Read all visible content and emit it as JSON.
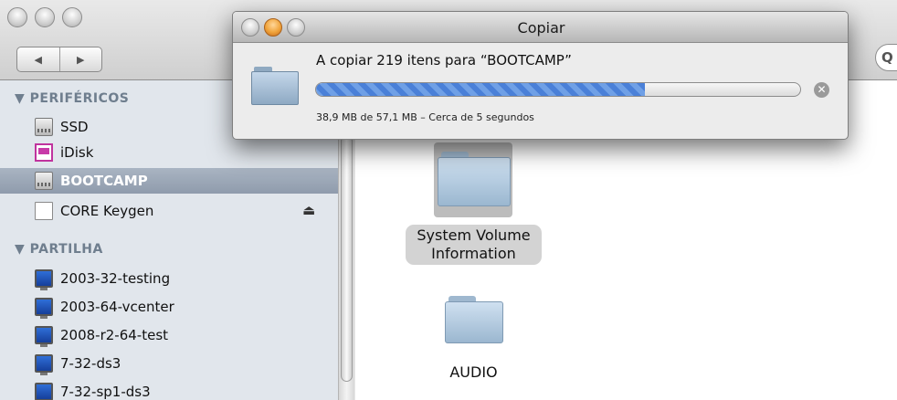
{
  "finder": {
    "nav_back": "◀",
    "nav_forward": "▶",
    "search_glyph": "Q",
    "sidebar": {
      "sections": [
        {
          "header": "▼ PERIFÉRICOS",
          "items": [
            {
              "label": "SSD",
              "icon": "drive-icon"
            },
            {
              "label": "iDisk",
              "icon": "idisk-icon"
            },
            {
              "label": "BOOTCAMP",
              "icon": "drive-icon",
              "selected": true
            },
            {
              "label": "CORE Keygen",
              "icon": "volume-icon",
              "eject": "⏏"
            }
          ]
        },
        {
          "header": "▼ PARTILHA",
          "items": [
            {
              "label": "2003-32-testing",
              "icon": "monitor-icon"
            },
            {
              "label": "2003-64-vcenter",
              "icon": "monitor-icon"
            },
            {
              "label": "2008-r2-64-test",
              "icon": "monitor-icon"
            },
            {
              "label": "7-32-ds3",
              "icon": "monitor-icon"
            },
            {
              "label": "7-32-sp1-ds3",
              "icon": "monitor-icon"
            }
          ]
        }
      ]
    },
    "content": {
      "items": [
        {
          "label_line1": "System Volume",
          "label_line2": "Information",
          "selected": true
        },
        {
          "label_line1": "AUDIO",
          "selected": false
        }
      ]
    }
  },
  "dialog": {
    "title": "Copiar",
    "message": "A copiar 219 itens para “BOOTCAMP”",
    "status": "38,9 MB de 57,1 MB – Cerca de 5 segundos",
    "progress_fraction": 0.68,
    "cancel_glyph": "✕"
  },
  "colors": {
    "sidebar_bg": "#e1e6ec",
    "selection": "#9aa5b6",
    "progress": "#4a80d8"
  }
}
